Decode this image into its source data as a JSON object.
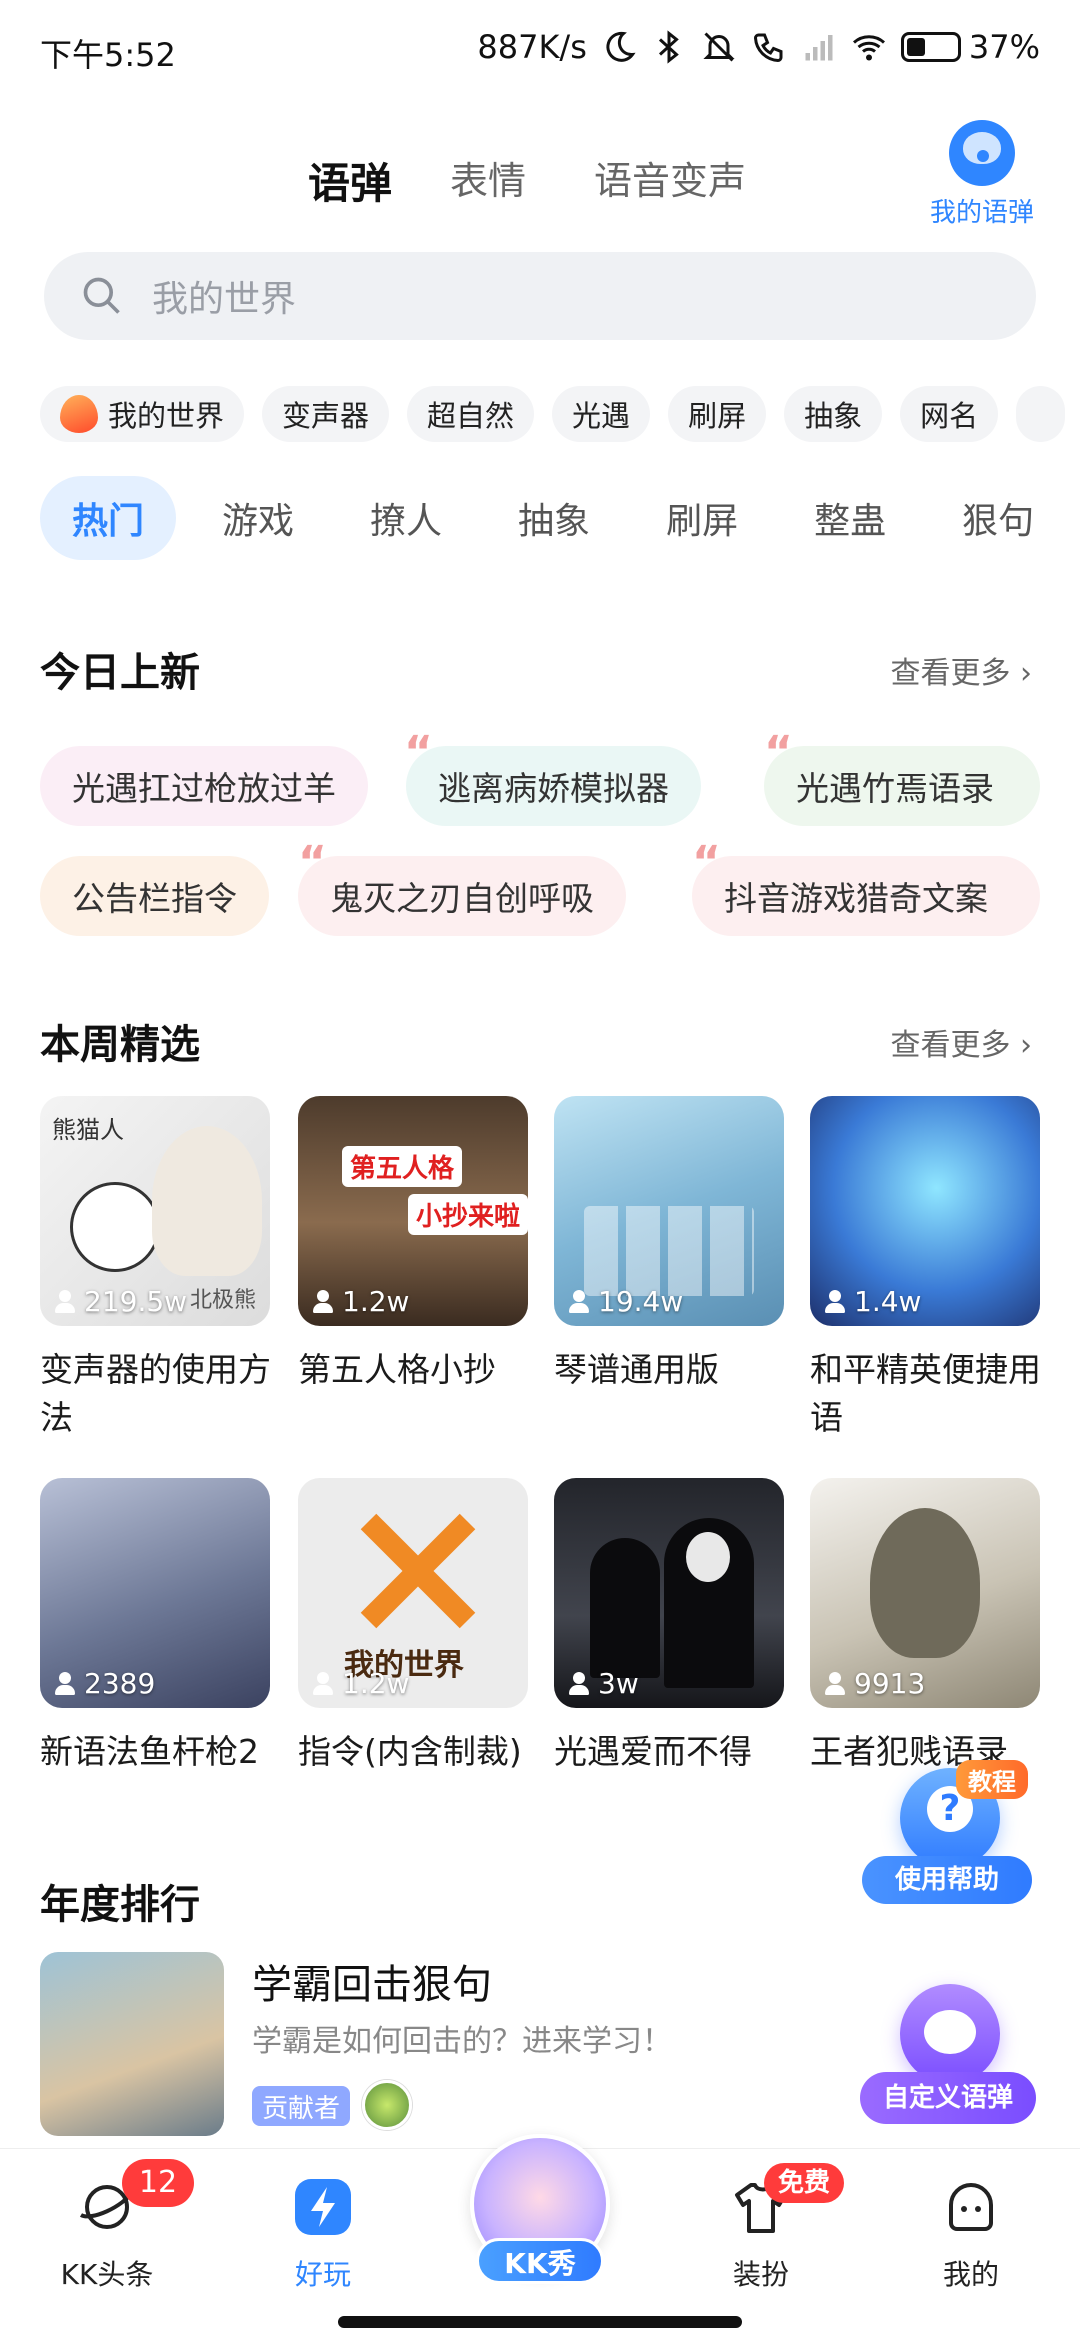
{
  "status_bar": {
    "time": "下午5:52",
    "network_speed": "887K/s",
    "battery": "37%",
    "battery_level": 0.37
  },
  "top_tabs": [
    {
      "label": "语弹",
      "active": true
    },
    {
      "label": "表情",
      "active": false
    },
    {
      "label": "语音变声",
      "active": false
    }
  ],
  "my_yudan": {
    "label": "我的语弹",
    "icon": "chat-bubble-icon"
  },
  "search": {
    "placeholder": "我的世界"
  },
  "hot_chips": [
    "我的世界",
    "变声器",
    "超自然",
    "光遇",
    "刷屏",
    "抽象",
    "网名"
  ],
  "categories": [
    {
      "label": "热门",
      "active": true
    },
    {
      "label": "游戏"
    },
    {
      "label": "撩人"
    },
    {
      "label": "抽象"
    },
    {
      "label": "刷屏"
    },
    {
      "label": "整蛊"
    },
    {
      "label": "狠句"
    }
  ],
  "new_today": {
    "title": "今日上新",
    "more": "查看更多 ›",
    "items": [
      {
        "label": "光遇扛过枪放过羊",
        "bg": "#fbeef6"
      },
      {
        "label": "逃离病娇模拟器",
        "bg": "#eaf7f5"
      },
      {
        "label": "光遇竹焉语录",
        "bg": "#eef7ee"
      },
      {
        "label": "公告栏指令",
        "bg": "#fdf1e6"
      },
      {
        "label": "鬼灭之刃自创呼吸",
        "bg": "#fdeff0"
      },
      {
        "label": "抖音游戏猎奇文案",
        "bg": "#fdeff0"
      }
    ]
  },
  "weekly": {
    "title": "本周精选",
    "more": "查看更多 ›",
    "items": [
      {
        "title": "变声器的使用方法",
        "count": "219.5w",
        "thumb_text_top": "熊猫人",
        "thumb_text_bottom": "北极熊"
      },
      {
        "title": "第五人格小抄",
        "count": "1.2w",
        "thumb_tag1": "第五人格",
        "thumb_tag2": "小抄来啦"
      },
      {
        "title": "琴谱通用版",
        "count": "19.4w"
      },
      {
        "title": "和平精英便捷用语",
        "count": "1.4w"
      },
      {
        "title": "新语法鱼杆枪2",
        "count": "2389"
      },
      {
        "title": "指令(内含制裁)",
        "count": "1.2w",
        "thumb_text": "我的世界"
      },
      {
        "title": "光遇爱而不得",
        "count": "3w"
      },
      {
        "title": "王者犯贱语录",
        "count": "9913"
      }
    ]
  },
  "ranking": {
    "title": "年度排行",
    "item": {
      "title": "学霸回击狠句",
      "subtitle": "学霸是如何回击的？进来学习！",
      "badge": "贡献者"
    }
  },
  "floating": {
    "help": {
      "tag": "教程",
      "label": "使用帮助",
      "icon": "question-icon"
    },
    "custom": {
      "label": "自定义语弹",
      "icon": "pacman-icon"
    }
  },
  "bottom_nav": [
    {
      "label": "KK头条",
      "badge": "12",
      "icon": "planet-icon"
    },
    {
      "label": "好玩",
      "active": true,
      "icon": "lightning-icon"
    },
    {
      "label": "KK秀",
      "icon": "avatar-icon"
    },
    {
      "label": "装扮",
      "badge": "免费",
      "icon": "tshirt-icon"
    },
    {
      "label": "我的",
      "icon": "face-icon"
    }
  ],
  "colors": {
    "accent": "#2f86ff",
    "highlight": "#ffd83a",
    "badge_red": "#ff3b3b"
  }
}
